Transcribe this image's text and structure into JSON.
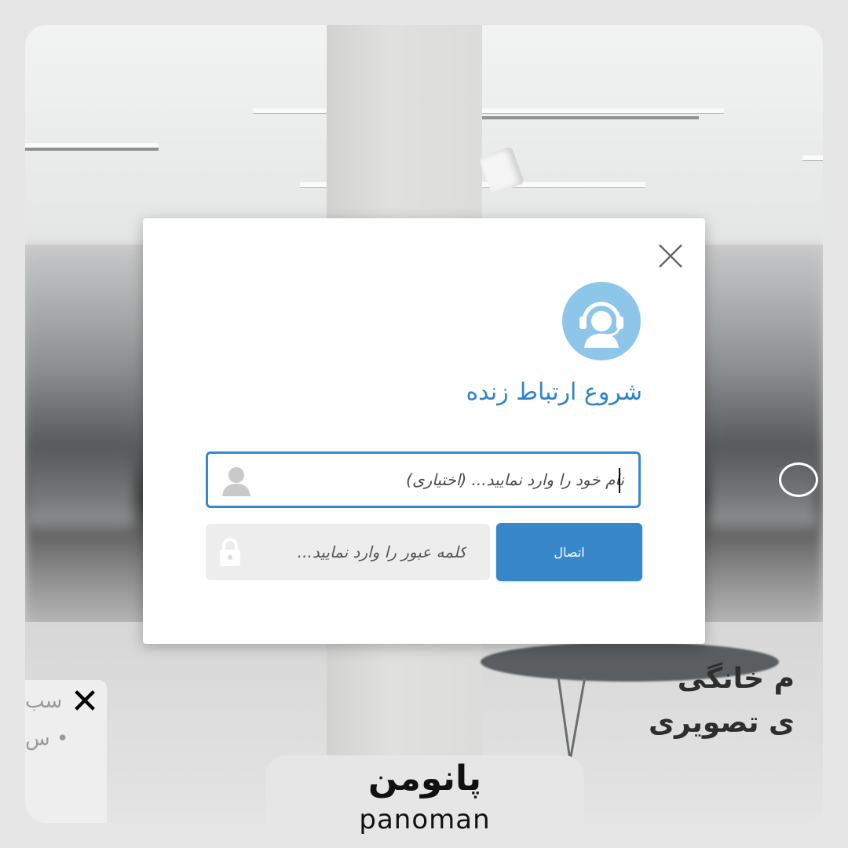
{
  "modal": {
    "title": "شروع ارتباط زنده",
    "name_placeholder": "نام خود را وارد نمایید... (اختیاری)",
    "password_placeholder": "کلمه عبور را وارد نمایید...",
    "connect_label": "اتصال",
    "accent_color": "#3787c9",
    "avatar_color": "#8ec6ea",
    "icons": {
      "close": "close-icon",
      "support": "headset-support-icon",
      "user": "user-icon",
      "lock": "lock-icon"
    }
  },
  "background": {
    "caption_line1": "م خانگی",
    "caption_line2": "ی تصویری"
  },
  "side_panel": {
    "text_line1": "سب",
    "text_line2": "• س",
    "close_label": "✕"
  },
  "brand": {
    "name_fa": "پانومن",
    "name_en": "panoman"
  }
}
